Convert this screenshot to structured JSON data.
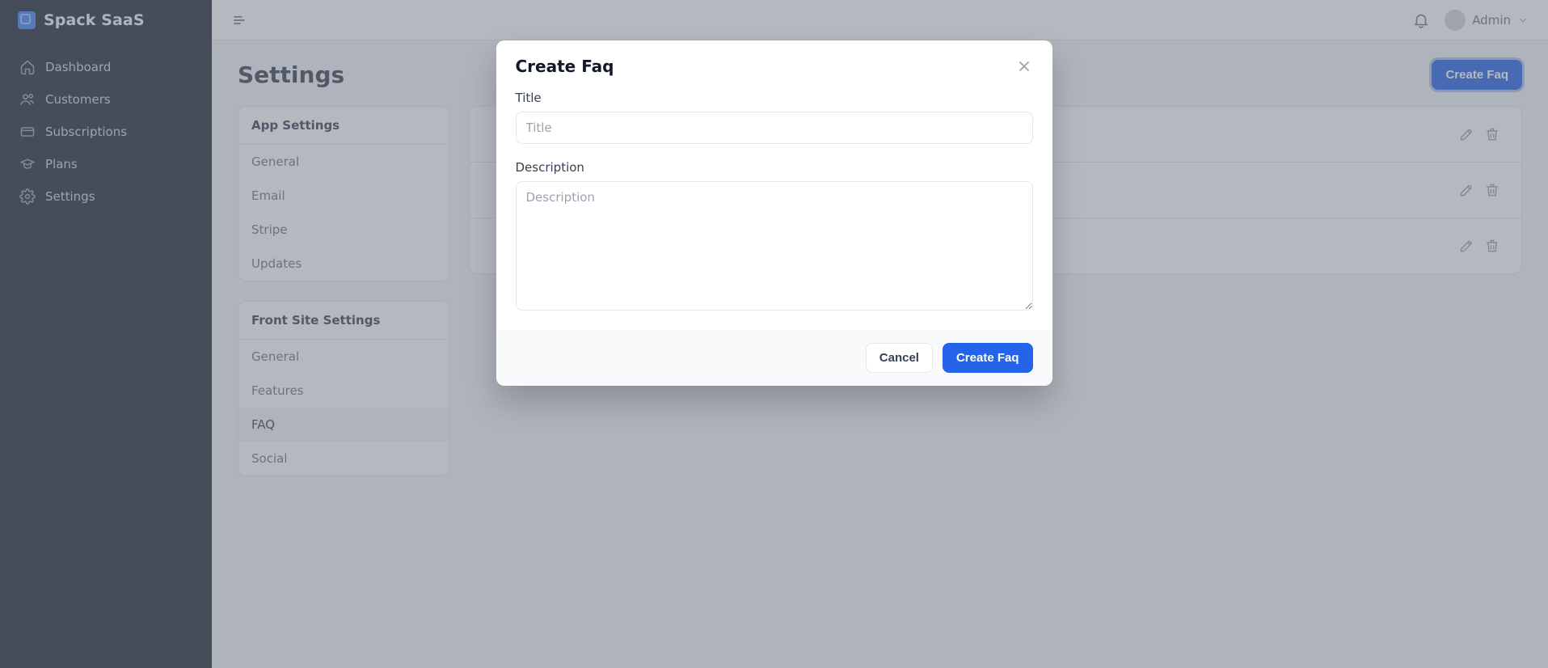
{
  "brand": {
    "name": "Spack SaaS"
  },
  "sidebar": {
    "items": [
      {
        "label": "Dashboard",
        "icon": "home-icon"
      },
      {
        "label": "Customers",
        "icon": "users-icon"
      },
      {
        "label": "Subscriptions",
        "icon": "credit-card-icon"
      },
      {
        "label": "Plans",
        "icon": "academic-cap-icon"
      },
      {
        "label": "Settings",
        "icon": "gear-icon"
      }
    ]
  },
  "topbar": {
    "user_name": "Admin"
  },
  "page": {
    "title": "Settings",
    "create_button": "Create Faq"
  },
  "settings_nav": {
    "app": {
      "title": "App Settings",
      "items": [
        "General",
        "Email",
        "Stripe",
        "Updates"
      ]
    },
    "front": {
      "title": "Front Site Settings",
      "items": [
        "General",
        "Features",
        "FAQ",
        "Social"
      ],
      "active_index": 2
    }
  },
  "faq_list": {
    "rows": 3
  },
  "modal": {
    "title": "Create Faq",
    "title_label": "Title",
    "title_placeholder": "Title",
    "description_label": "Description",
    "description_placeholder": "Description",
    "cancel_label": "Cancel",
    "submit_label": "Create Faq"
  }
}
